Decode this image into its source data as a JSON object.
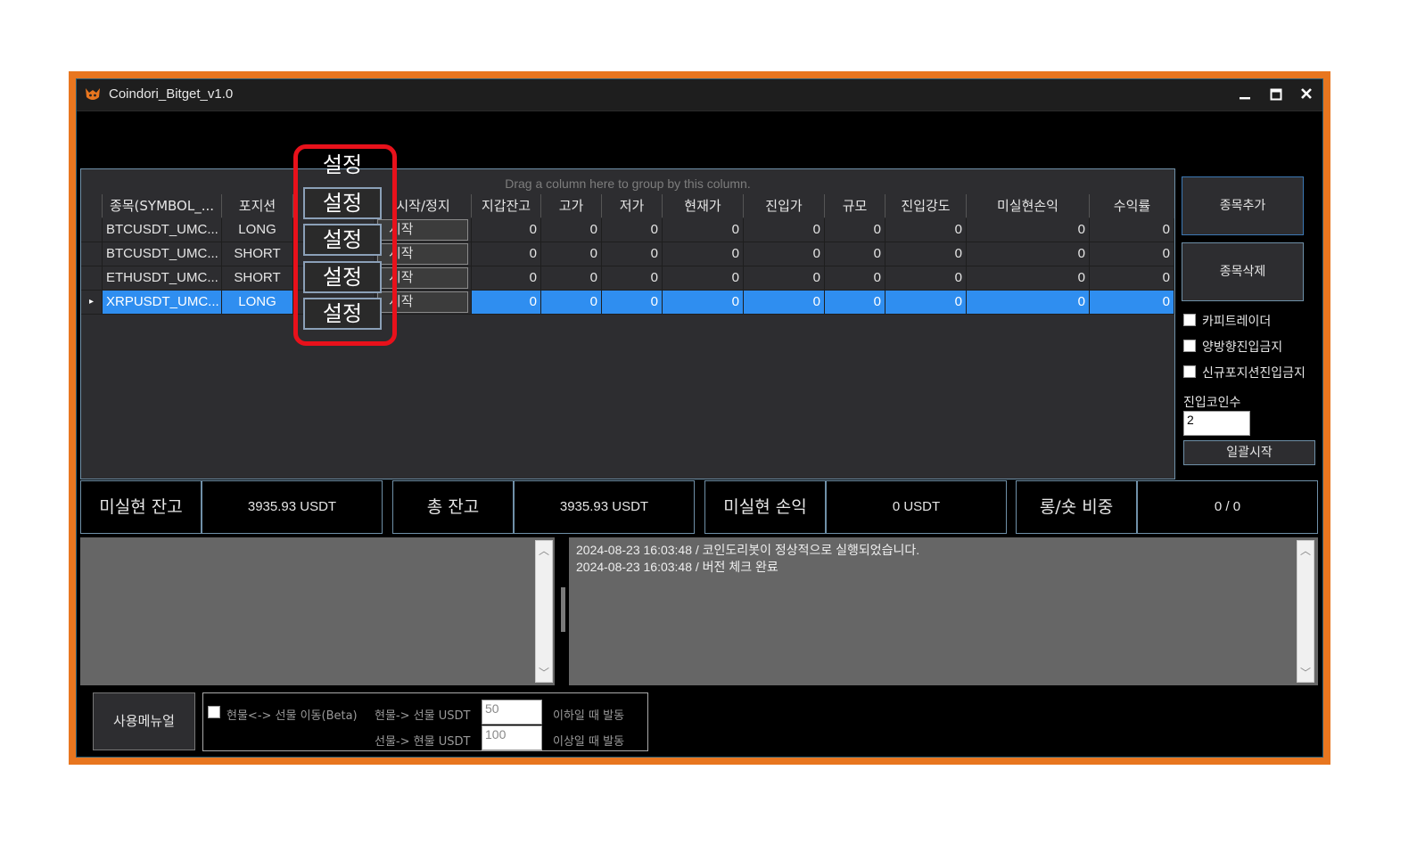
{
  "window": {
    "title": "Coindori_Bitget_v1.0",
    "minimize_icon": "minimize-icon",
    "maximize_icon": "maximize-icon",
    "close_icon": "close-icon"
  },
  "grid": {
    "group_panel_text": "Drag a column here to group by this column.",
    "setting_header": "설정",
    "setting_button_label": "설정",
    "columns": [
      "종목(SYMBOL_...",
      "포지션",
      "설정",
      "시작/정지",
      "지갑잔고",
      "고가",
      "저가",
      "현재가",
      "진입가",
      "규모",
      "진입강도",
      "미실현손익",
      "수익률"
    ],
    "rows": [
      {
        "symbol": "BTCUSDT_UMC...",
        "position": "LONG",
        "action": "시작",
        "wallet": "0",
        "high": "0",
        "low": "0",
        "current": "0",
        "entry": "0",
        "size": "0",
        "strength": "0",
        "unrealized": "0",
        "roi": "0",
        "selected": false
      },
      {
        "symbol": "BTCUSDT_UMC...",
        "position": "SHORT",
        "action": "시작",
        "wallet": "0",
        "high": "0",
        "low": "0",
        "current": "0",
        "entry": "0",
        "size": "0",
        "strength": "0",
        "unrealized": "0",
        "roi": "0",
        "selected": false
      },
      {
        "symbol": "ETHUSDT_UMC...",
        "position": "SHORT",
        "action": "시작",
        "wallet": "0",
        "high": "0",
        "low": "0",
        "current": "0",
        "entry": "0",
        "size": "0",
        "strength": "0",
        "unrealized": "0",
        "roi": "0",
        "selected": false
      },
      {
        "symbol": "XRPUSDT_UMC...",
        "position": "LONG",
        "action": "시작",
        "wallet": "0",
        "high": "0",
        "low": "0",
        "current": "0",
        "entry": "0",
        "size": "0",
        "strength": "0",
        "unrealized": "0",
        "roi": "0",
        "selected": true
      }
    ]
  },
  "right_panel": {
    "add_symbol_label": "종목추가",
    "delete_symbol_label": "종목삭제",
    "checkboxes": [
      "카피트레이더",
      "양방향진입금지",
      "신규포지션진입금지"
    ],
    "entry_count_label": "진입코인수",
    "entry_count_value": "2",
    "bulk_start_label": "일괄시작"
  },
  "stats": {
    "unrealized_balance_label": "미실현 잔고",
    "unrealized_balance_value": "3935.93 USDT",
    "total_balance_label": "총 잔고",
    "total_balance_value": "3935.93 USDT",
    "unrealized_pnl_label": "미실현 손익",
    "unrealized_pnl_value": "0 USDT",
    "long_short_label": "롱/숏 비중",
    "long_short_value": "0 / 0"
  },
  "log": {
    "lines": [
      "2024-08-23 16:03:48 / 코인도리봇이 정상적으로 실행되었습니다.",
      "2024-08-23 16:03:48 / 버전 체크 완료"
    ]
  },
  "bottom": {
    "manual_label": "사용메뉴얼",
    "transfer_label": "현물<-> 선물 이동(Beta)",
    "spot_to_futures_label": "현물-> 선물 USDT",
    "spot_to_futures_value": "50",
    "spot_to_futures_suffix": "이하일 때 발동",
    "futures_to_spot_label": "선물-> 현물 USDT",
    "futures_to_spot_value": "100",
    "futures_to_spot_suffix": "이상일 때 발동"
  },
  "colors": {
    "window_border": "#e8761f",
    "selection": "#2f8ef0",
    "highlight": "#e8111b"
  }
}
